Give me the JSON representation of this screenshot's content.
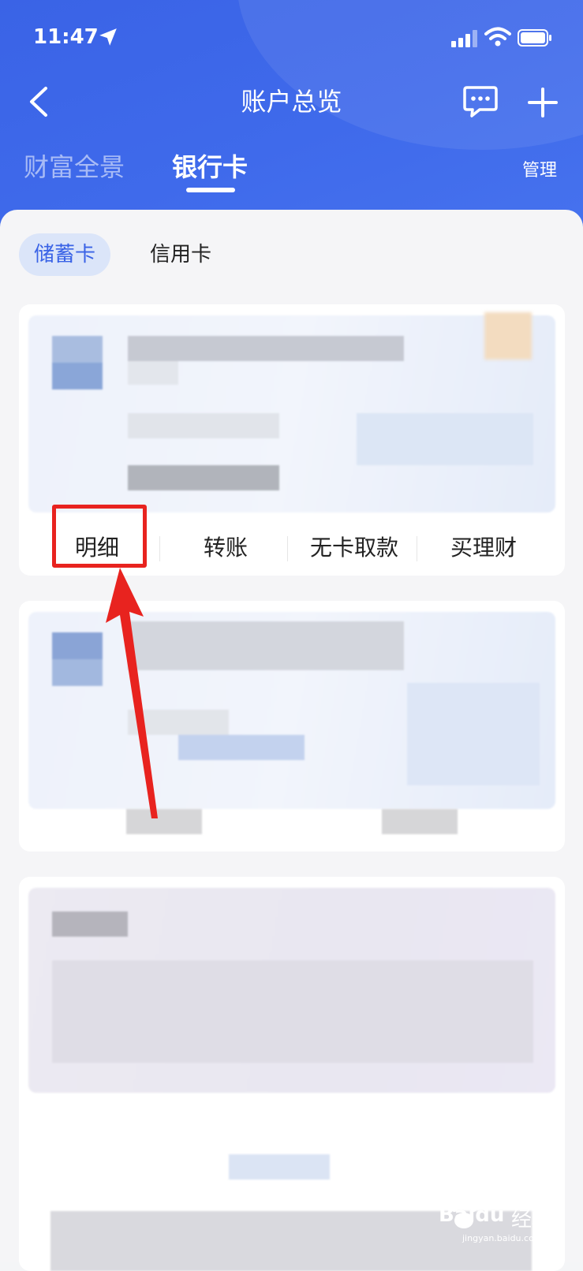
{
  "status_bar": {
    "time": "11:47"
  },
  "nav": {
    "title": "账户总览"
  },
  "tabs": {
    "wealth": "财富全景",
    "bank_card": "银行卡",
    "manage": "管理"
  },
  "card_type": {
    "debit": "储蓄卡",
    "credit": "信用卡"
  },
  "card_actions": [
    "明细",
    "转账",
    "无卡取款",
    "买理财"
  ],
  "watermark": {
    "brand": "Baidu",
    "label": "经验",
    "site": "jingyan.baidu.com"
  },
  "colors": {
    "primary": "#3a63e6",
    "highlight": "#e8231f"
  }
}
